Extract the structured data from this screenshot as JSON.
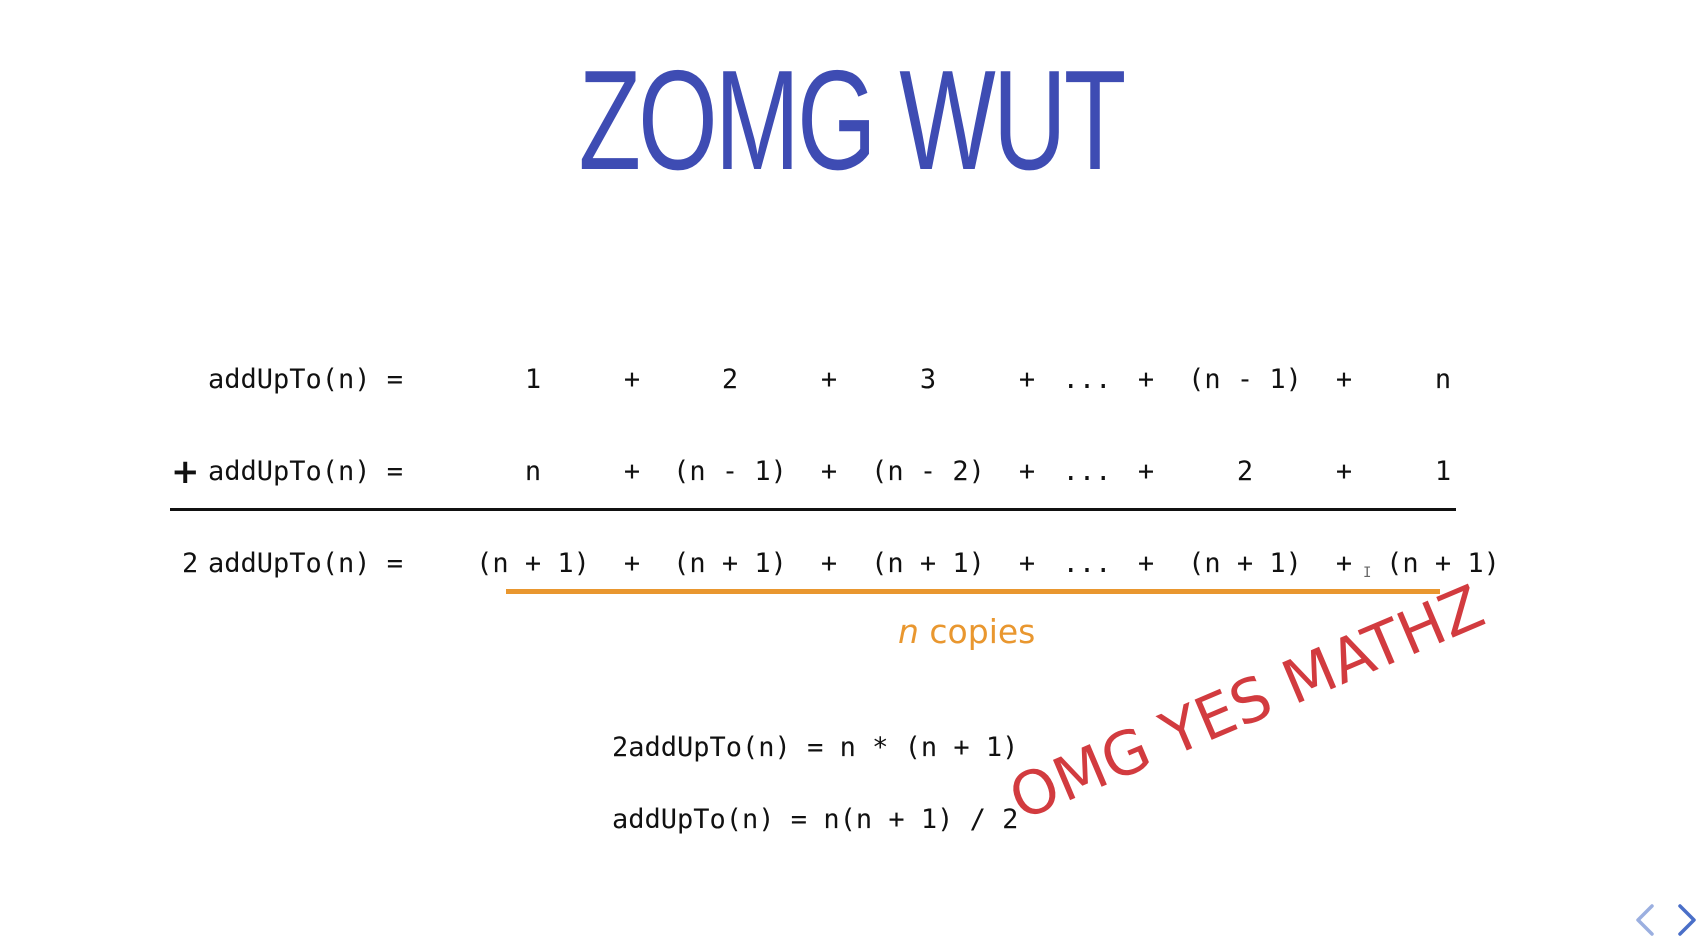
{
  "slide": {
    "title": "ZOMG WUT"
  },
  "equation": {
    "row1": {
      "lhs": "addUpTo(n) =",
      "terms": [
        "1",
        "+",
        "2",
        "+",
        "3",
        "+",
        "...",
        "+",
        "(n - 1)",
        "+",
        "n"
      ]
    },
    "row2": {
      "operator": "+",
      "lhs": "addUpTo(n) =",
      "terms": [
        "n",
        "+",
        "(n - 1)",
        "+",
        "(n - 2)",
        "+",
        "...",
        "+",
        "2",
        "+",
        "1"
      ]
    },
    "row3": {
      "coefficient": "2",
      "lhs": "addUpTo(n) =",
      "terms": [
        "(n + 1)",
        "+",
        "(n + 1)",
        "+",
        "(n + 1)",
        "+",
        "...",
        "+",
        "(n + 1)",
        "+",
        "(n + 1)"
      ]
    },
    "copies_var": "n",
    "copies_text": " copies"
  },
  "results": {
    "line1": "2addUpTo(n) = n * (n + 1)",
    "line2": "addUpTo(n) = n(n + 1) / 2"
  },
  "stamp": "OMG YES MATHZ",
  "cursor_glyph": "I",
  "colors": {
    "title": "#3e4cb3",
    "accent_orange": "#e9972f",
    "stamp_red": "#d23b3f",
    "nav_blue": "#4a6fc8"
  },
  "icons": {
    "prev": "chevron-left-icon",
    "next": "chevron-right-icon"
  }
}
